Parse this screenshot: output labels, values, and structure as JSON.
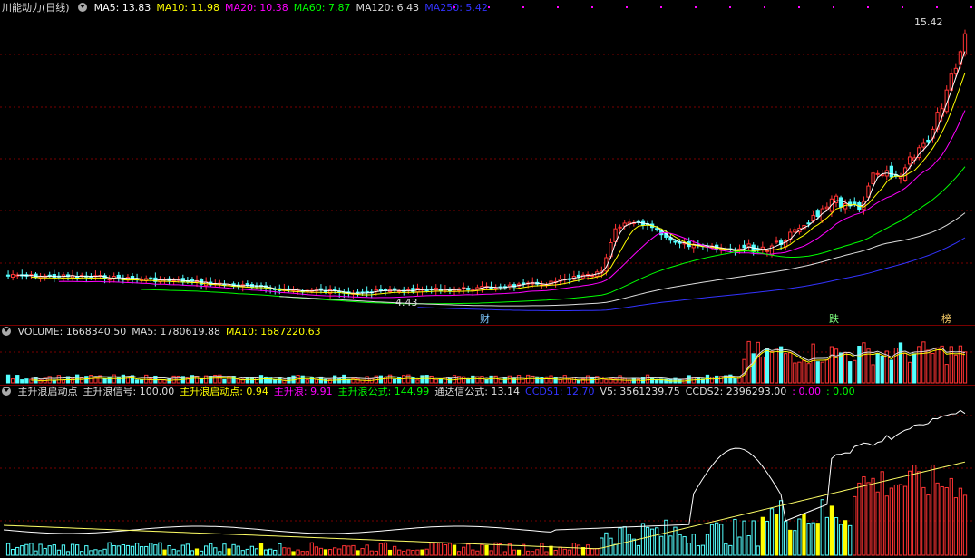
{
  "price_panel": {
    "stock_name": "川能动力(日线)",
    "ma": [
      {
        "label": "MA5: 13.83",
        "color": "#ffffff"
      },
      {
        "label": "MA10: 11.98",
        "color": "#ffff00"
      },
      {
        "label": "MA20: 10.38",
        "color": "#ff00ff"
      },
      {
        "label": "MA60: 7.87",
        "color": "#00ff00"
      },
      {
        "label": "MA120: 6.43",
        "color": "#dddddd"
      },
      {
        "label": "MA250: 5.42",
        "color": "#3333ff"
      }
    ],
    "high_label": "15.42",
    "low_label": "4.43",
    "markers": [
      "财",
      "跌",
      "榜"
    ],
    "colors": {
      "up": "#ff3333",
      "down": "#54ffff",
      "grid": "#7a0000"
    }
  },
  "volume_panel": {
    "items": [
      {
        "label": "VOLUME: 1668340.50",
        "color": "#dddddd"
      },
      {
        "label": "MA5: 1780619.88",
        "color": "#dddddd"
      },
      {
        "label": "MA10: 1687220.63",
        "color": "#ffff00"
      }
    ]
  },
  "indicator_panel": {
    "items": [
      {
        "label": "主升浪启动点",
        "color": "#dddddd"
      },
      {
        "label": "主升浪信号: 100.00",
        "color": "#dddddd"
      },
      {
        "label": "主升浪启动点: 0.94",
        "color": "#ffff00"
      },
      {
        "label": "主升浪: 9.91",
        "color": "#ff00ff"
      },
      {
        "label": "主升浪公式: 144.99",
        "color": "#00ff00"
      },
      {
        "label": "通达信公式: 13.14",
        "color": "#dddddd"
      },
      {
        "label": "CCDS1: 12.70",
        "color": "#3333ff"
      },
      {
        "label": "V5: 3561239.75",
        "color": "#dddddd"
      },
      {
        "label": "CCDS2: 2396293.00",
        "color": "#dddddd"
      },
      {
        "label": ": 0.00",
        "color": "#ff00ff"
      },
      {
        "label": ": 0.00",
        "color": "#00ff00"
      }
    ]
  }
}
